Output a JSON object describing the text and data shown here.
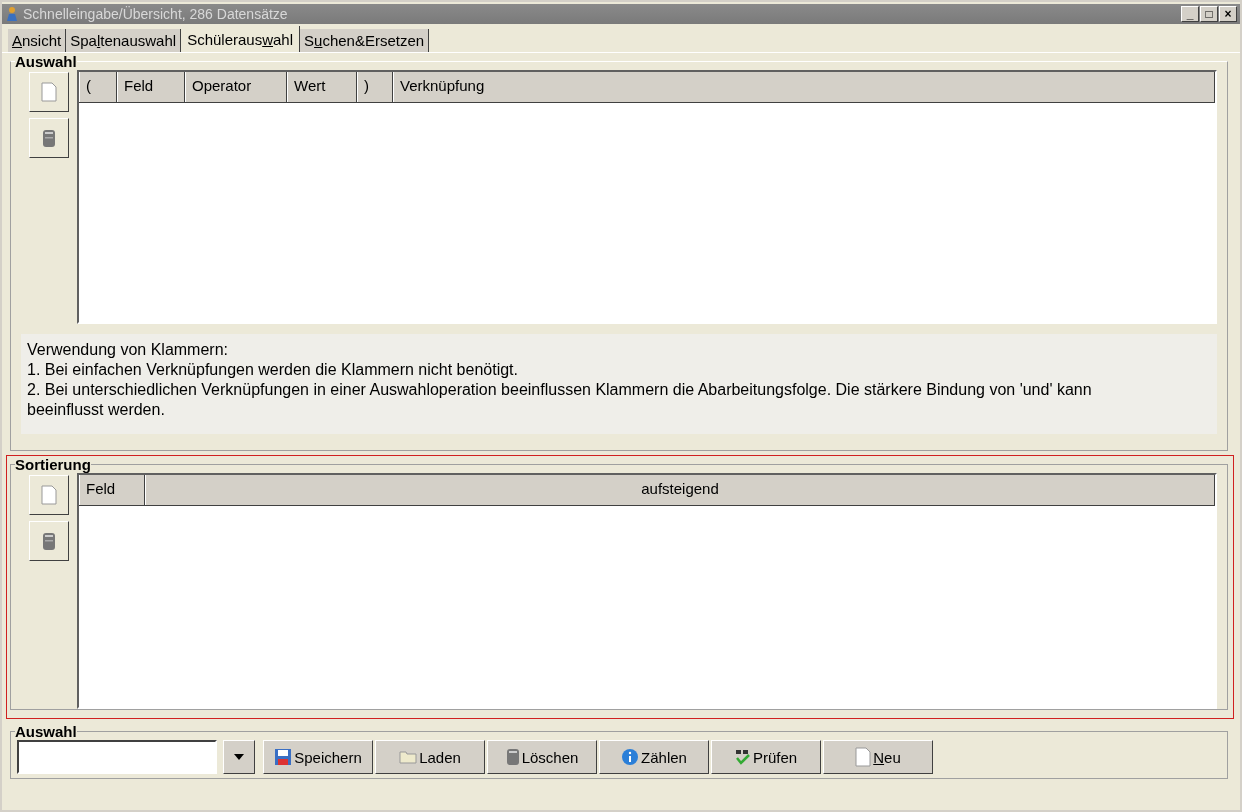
{
  "window": {
    "title": "Schnelleingabe/Übersicht, 286 Datensätze",
    "controls": [
      "_",
      "□",
      "×"
    ]
  },
  "tabs": [
    {
      "accel": "A",
      "after": "nsicht",
      "selected": false
    },
    {
      "before": "Spa",
      "accel": "l",
      "after": "tenauswahl",
      "selected": false
    },
    {
      "before": "Schüleraus",
      "accel": "w",
      "after": "ahl",
      "selected": true
    },
    {
      "before": "S",
      "accel": "u",
      "after": "chen&Ersetzen",
      "selected": false
    }
  ],
  "selection": {
    "title": "Auswahl",
    "columns": [
      "(",
      "Feld",
      "Operator",
      "Wert",
      ")",
      "Verknüpfung"
    ]
  },
  "help": [
    "Verwendung von Klammern:",
    "1. Bei einfachen Verknüpfungen werden die Klammern nicht benötigt.",
    "2. Bei unterschiedlichen Verknüpfungen in einer Auswahloperation beeinflussen Klammern die Abarbeitungsfolge. Die stärkere Bindung von 'und' kann beeinflusst werden."
  ],
  "sorting": {
    "title": "Sortierung",
    "columns": [
      "Feld",
      "aufsteigend"
    ]
  },
  "saved": {
    "title": "Auswahl",
    "buttons": [
      {
        "kind": "save",
        "before": "Speichern"
      },
      {
        "kind": "load",
        "before": "Laden"
      },
      {
        "kind": "delete",
        "before": "Löschen"
      },
      {
        "kind": "count",
        "before": "Zählen"
      },
      {
        "kind": "check",
        "before": "Prüfen"
      },
      {
        "kind": "new",
        "accel": "N",
        "after": "eu"
      }
    ]
  }
}
